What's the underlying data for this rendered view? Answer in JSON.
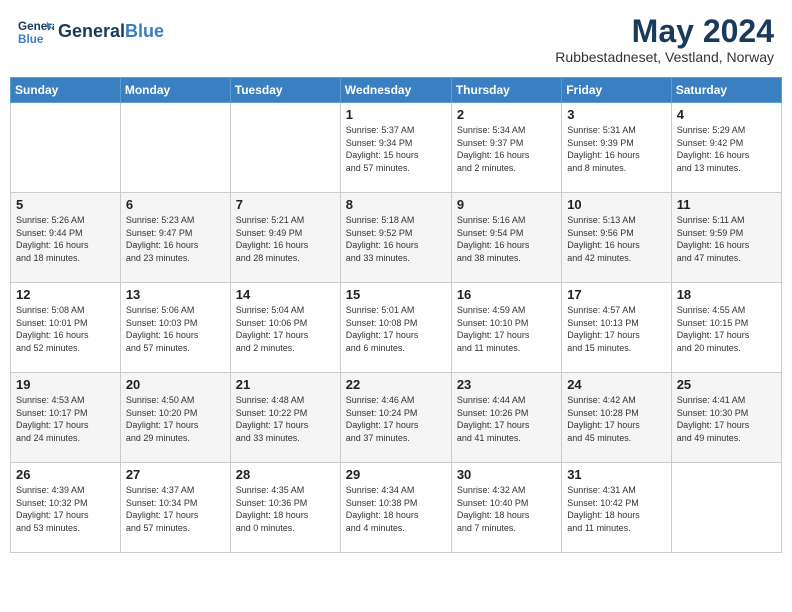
{
  "header": {
    "logo_general": "General",
    "logo_blue": "Blue",
    "month": "May 2024",
    "location": "Rubbestadneset, Vestland, Norway"
  },
  "days_of_week": [
    "Sunday",
    "Monday",
    "Tuesday",
    "Wednesday",
    "Thursday",
    "Friday",
    "Saturday"
  ],
  "weeks": [
    [
      {
        "day": "",
        "info": ""
      },
      {
        "day": "",
        "info": ""
      },
      {
        "day": "",
        "info": ""
      },
      {
        "day": "1",
        "info": "Sunrise: 5:37 AM\nSunset: 9:34 PM\nDaylight: 15 hours\nand 57 minutes."
      },
      {
        "day": "2",
        "info": "Sunrise: 5:34 AM\nSunset: 9:37 PM\nDaylight: 16 hours\nand 2 minutes."
      },
      {
        "day": "3",
        "info": "Sunrise: 5:31 AM\nSunset: 9:39 PM\nDaylight: 16 hours\nand 8 minutes."
      },
      {
        "day": "4",
        "info": "Sunrise: 5:29 AM\nSunset: 9:42 PM\nDaylight: 16 hours\nand 13 minutes."
      }
    ],
    [
      {
        "day": "5",
        "info": "Sunrise: 5:26 AM\nSunset: 9:44 PM\nDaylight: 16 hours\nand 18 minutes."
      },
      {
        "day": "6",
        "info": "Sunrise: 5:23 AM\nSunset: 9:47 PM\nDaylight: 16 hours\nand 23 minutes."
      },
      {
        "day": "7",
        "info": "Sunrise: 5:21 AM\nSunset: 9:49 PM\nDaylight: 16 hours\nand 28 minutes."
      },
      {
        "day": "8",
        "info": "Sunrise: 5:18 AM\nSunset: 9:52 PM\nDaylight: 16 hours\nand 33 minutes."
      },
      {
        "day": "9",
        "info": "Sunrise: 5:16 AM\nSunset: 9:54 PM\nDaylight: 16 hours\nand 38 minutes."
      },
      {
        "day": "10",
        "info": "Sunrise: 5:13 AM\nSunset: 9:56 PM\nDaylight: 16 hours\nand 42 minutes."
      },
      {
        "day": "11",
        "info": "Sunrise: 5:11 AM\nSunset: 9:59 PM\nDaylight: 16 hours\nand 47 minutes."
      }
    ],
    [
      {
        "day": "12",
        "info": "Sunrise: 5:08 AM\nSunset: 10:01 PM\nDaylight: 16 hours\nand 52 minutes."
      },
      {
        "day": "13",
        "info": "Sunrise: 5:06 AM\nSunset: 10:03 PM\nDaylight: 16 hours\nand 57 minutes."
      },
      {
        "day": "14",
        "info": "Sunrise: 5:04 AM\nSunset: 10:06 PM\nDaylight: 17 hours\nand 2 minutes."
      },
      {
        "day": "15",
        "info": "Sunrise: 5:01 AM\nSunset: 10:08 PM\nDaylight: 17 hours\nand 6 minutes."
      },
      {
        "day": "16",
        "info": "Sunrise: 4:59 AM\nSunset: 10:10 PM\nDaylight: 17 hours\nand 11 minutes."
      },
      {
        "day": "17",
        "info": "Sunrise: 4:57 AM\nSunset: 10:13 PM\nDaylight: 17 hours\nand 15 minutes."
      },
      {
        "day": "18",
        "info": "Sunrise: 4:55 AM\nSunset: 10:15 PM\nDaylight: 17 hours\nand 20 minutes."
      }
    ],
    [
      {
        "day": "19",
        "info": "Sunrise: 4:53 AM\nSunset: 10:17 PM\nDaylight: 17 hours\nand 24 minutes."
      },
      {
        "day": "20",
        "info": "Sunrise: 4:50 AM\nSunset: 10:20 PM\nDaylight: 17 hours\nand 29 minutes."
      },
      {
        "day": "21",
        "info": "Sunrise: 4:48 AM\nSunset: 10:22 PM\nDaylight: 17 hours\nand 33 minutes."
      },
      {
        "day": "22",
        "info": "Sunrise: 4:46 AM\nSunset: 10:24 PM\nDaylight: 17 hours\nand 37 minutes."
      },
      {
        "day": "23",
        "info": "Sunrise: 4:44 AM\nSunset: 10:26 PM\nDaylight: 17 hours\nand 41 minutes."
      },
      {
        "day": "24",
        "info": "Sunrise: 4:42 AM\nSunset: 10:28 PM\nDaylight: 17 hours\nand 45 minutes."
      },
      {
        "day": "25",
        "info": "Sunrise: 4:41 AM\nSunset: 10:30 PM\nDaylight: 17 hours\nand 49 minutes."
      }
    ],
    [
      {
        "day": "26",
        "info": "Sunrise: 4:39 AM\nSunset: 10:32 PM\nDaylight: 17 hours\nand 53 minutes."
      },
      {
        "day": "27",
        "info": "Sunrise: 4:37 AM\nSunset: 10:34 PM\nDaylight: 17 hours\nand 57 minutes."
      },
      {
        "day": "28",
        "info": "Sunrise: 4:35 AM\nSunset: 10:36 PM\nDaylight: 18 hours\nand 0 minutes."
      },
      {
        "day": "29",
        "info": "Sunrise: 4:34 AM\nSunset: 10:38 PM\nDaylight: 18 hours\nand 4 minutes."
      },
      {
        "day": "30",
        "info": "Sunrise: 4:32 AM\nSunset: 10:40 PM\nDaylight: 18 hours\nand 7 minutes."
      },
      {
        "day": "31",
        "info": "Sunrise: 4:31 AM\nSunset: 10:42 PM\nDaylight: 18 hours\nand 11 minutes."
      },
      {
        "day": "",
        "info": ""
      }
    ]
  ]
}
